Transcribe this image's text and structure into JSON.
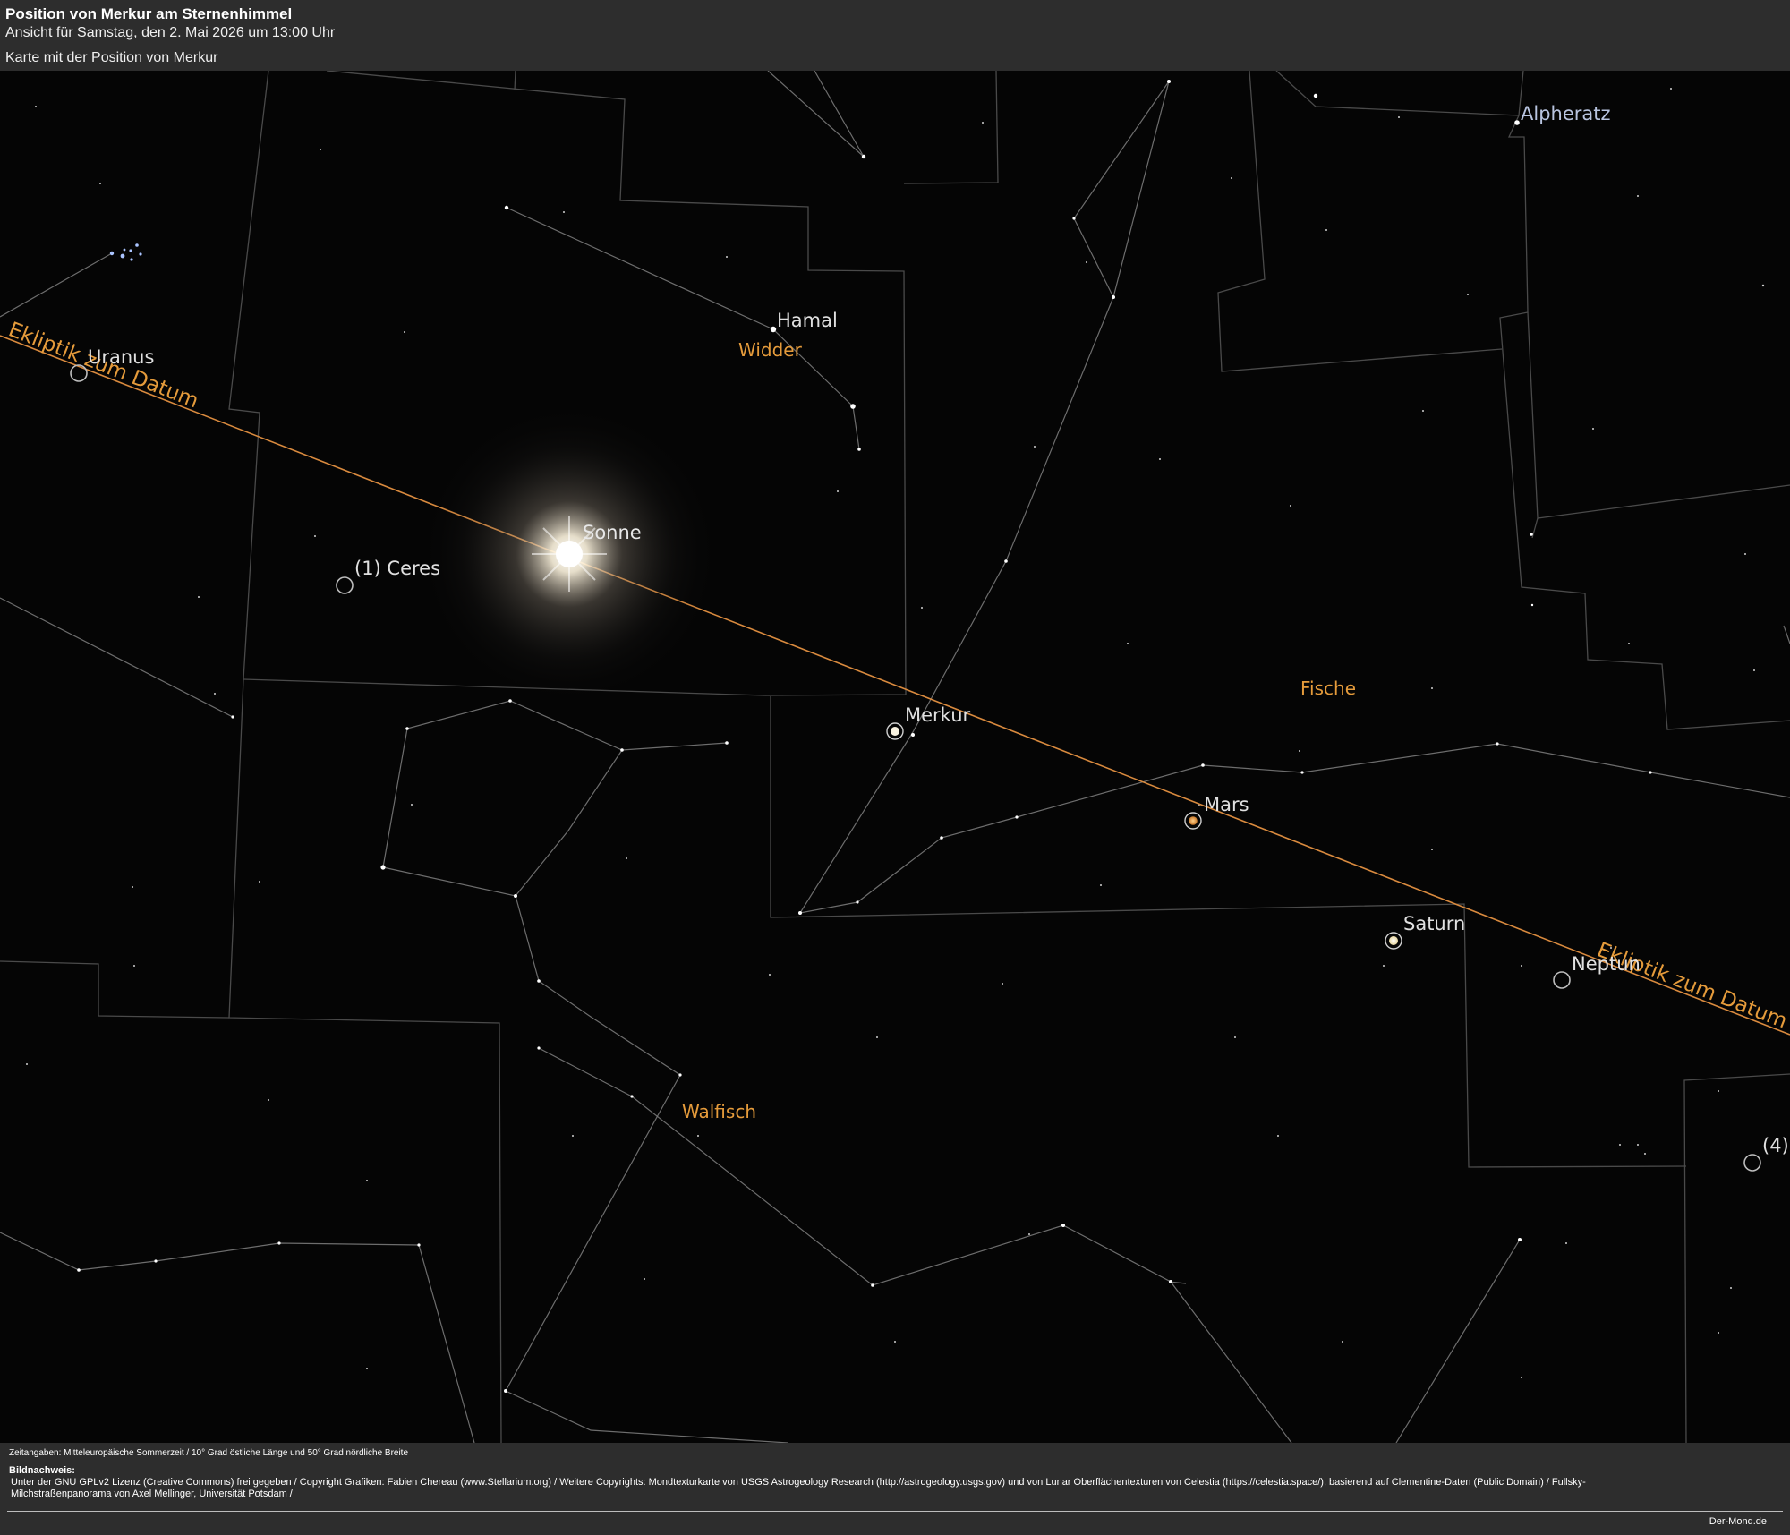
{
  "header": {
    "title": "Position von Merkur am Sternenhimmel",
    "subtitle": "Ansicht für Samstag, den 2. Mai 2026 um 13:00 Uhr",
    "caption": "Karte mit der Position von Merkur"
  },
  "map": {
    "bodies": {
      "sonne": "Sonne",
      "merkur": "Merkur",
      "mars": "Mars",
      "saturn": "Saturn",
      "neptun": "Neptun",
      "uranus": "Uranus",
      "ceres": "(1) Ceres",
      "vesta": "(4)"
    },
    "stars": {
      "hamal": "Hamal",
      "alpheratz": "Alpheratz"
    },
    "constellations": {
      "widder": "Widder",
      "fische": "Fische",
      "walfisch": "Walfisch"
    },
    "ecliptic": {
      "label_left": "Ekliptik zum Datum",
      "label_right": "Ekliptik zum Datum",
      "color": "#e08a3c"
    },
    "label_color": "#e0e0e0",
    "constellation_color": "#e59b3b"
  },
  "footer": {
    "zeit": "Zeitangaben: Mitteleuropäische Sommerzeit / 10° Grad östliche Länge und 50° Grad nördliche Breite",
    "credits_title": "Bildnachweis:",
    "credits_text": "Unter der GNU GPLv2 Lizenz (Creative Commons) frei gegeben / Copyright Grafiken: Fabien Chereau (www.Stellarium.org) / Weitere Copyrights: Mondtexturkarte von USGS Astrogeology Research (http://astrogeology.usgs.gov) und von Lunar Oberflächentexturen von Celestia (https://celestia.space/), basierend auf Clementine-Daten (Public Domain) / Fullsky-Milchstraßenpanorama von Axel Mellinger, Universität Potsdam /",
    "site": "Der-Mond.de"
  }
}
